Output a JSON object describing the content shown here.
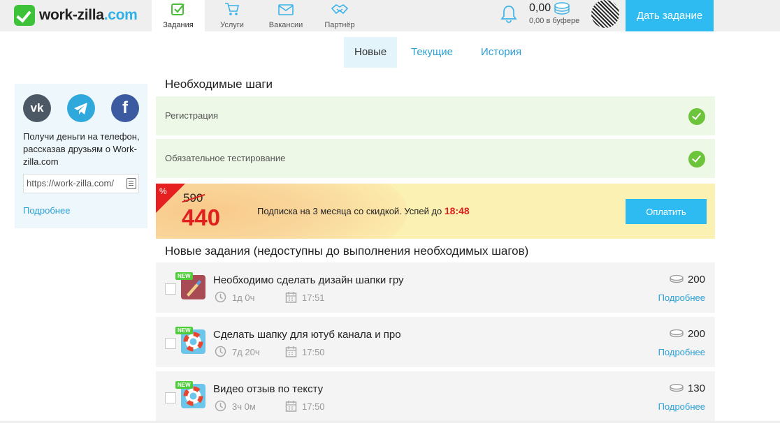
{
  "header": {
    "logo": {
      "name": "work-zilla",
      "dot": ".com"
    },
    "tabs": [
      {
        "label": "Задания",
        "icon": "tasks-check-icon",
        "active": true
      },
      {
        "label": "Услуги",
        "icon": "cart-icon",
        "active": false
      },
      {
        "label": "Вакансии",
        "icon": "envelope-icon",
        "active": false
      },
      {
        "label": "Партнёр",
        "icon": "handshake-icon",
        "active": false
      }
    ],
    "balance": "0,00",
    "buffer": "0,00 в буфере",
    "give_task": "Дать задание"
  },
  "subtabs": [
    {
      "label": "Новые",
      "active": true
    },
    {
      "label": "Текущие",
      "active": false
    },
    {
      "label": "История",
      "active": false
    }
  ],
  "sidebar": {
    "text": "Получи деньги на телефон, рассказав друзьям о Work-zilla.com",
    "ref_link": "https://work-zilla.com/",
    "more": "Подробнее"
  },
  "steps": {
    "heading": "Необходимые шаги",
    "items": [
      {
        "label": "Регистрация",
        "done": true
      },
      {
        "label": "Обязательное тестирование",
        "done": true
      }
    ]
  },
  "promo": {
    "percent": "%",
    "old_price": "590",
    "new_price": "440",
    "text": "Подписка на 3 месяца со скидкой. Успей до",
    "deadline": "18:48",
    "button": "Оплатить"
  },
  "tasks": {
    "heading": "Новые задания (недоступны до выполнения необходимых шагов)",
    "badge": "NEW",
    "more": "Подробнее",
    "items": [
      {
        "title": "Необходимо сделать дизайн шапки гру",
        "duration": "1д 0ч",
        "time": "17:51",
        "price": "200",
        "category_icon": "design-brush-icon"
      },
      {
        "title": "Сделать шапку для ютуб канала и про",
        "duration": "7д 20ч",
        "time": "17:50",
        "price": "200",
        "category_icon": "lifebuoy-icon"
      },
      {
        "title": "Видео отзыв по тексту",
        "duration": "3ч 0м",
        "time": "17:50",
        "price": "130",
        "category_icon": "lifebuoy-icon"
      }
    ]
  },
  "colors": {
    "accent": "#2ebbf2",
    "link": "#2a9fd6",
    "success": "#6cc43a",
    "danger": "#e01f1f",
    "step_bg": "#edf8e6",
    "promo_bg": "#fbf1b3"
  }
}
